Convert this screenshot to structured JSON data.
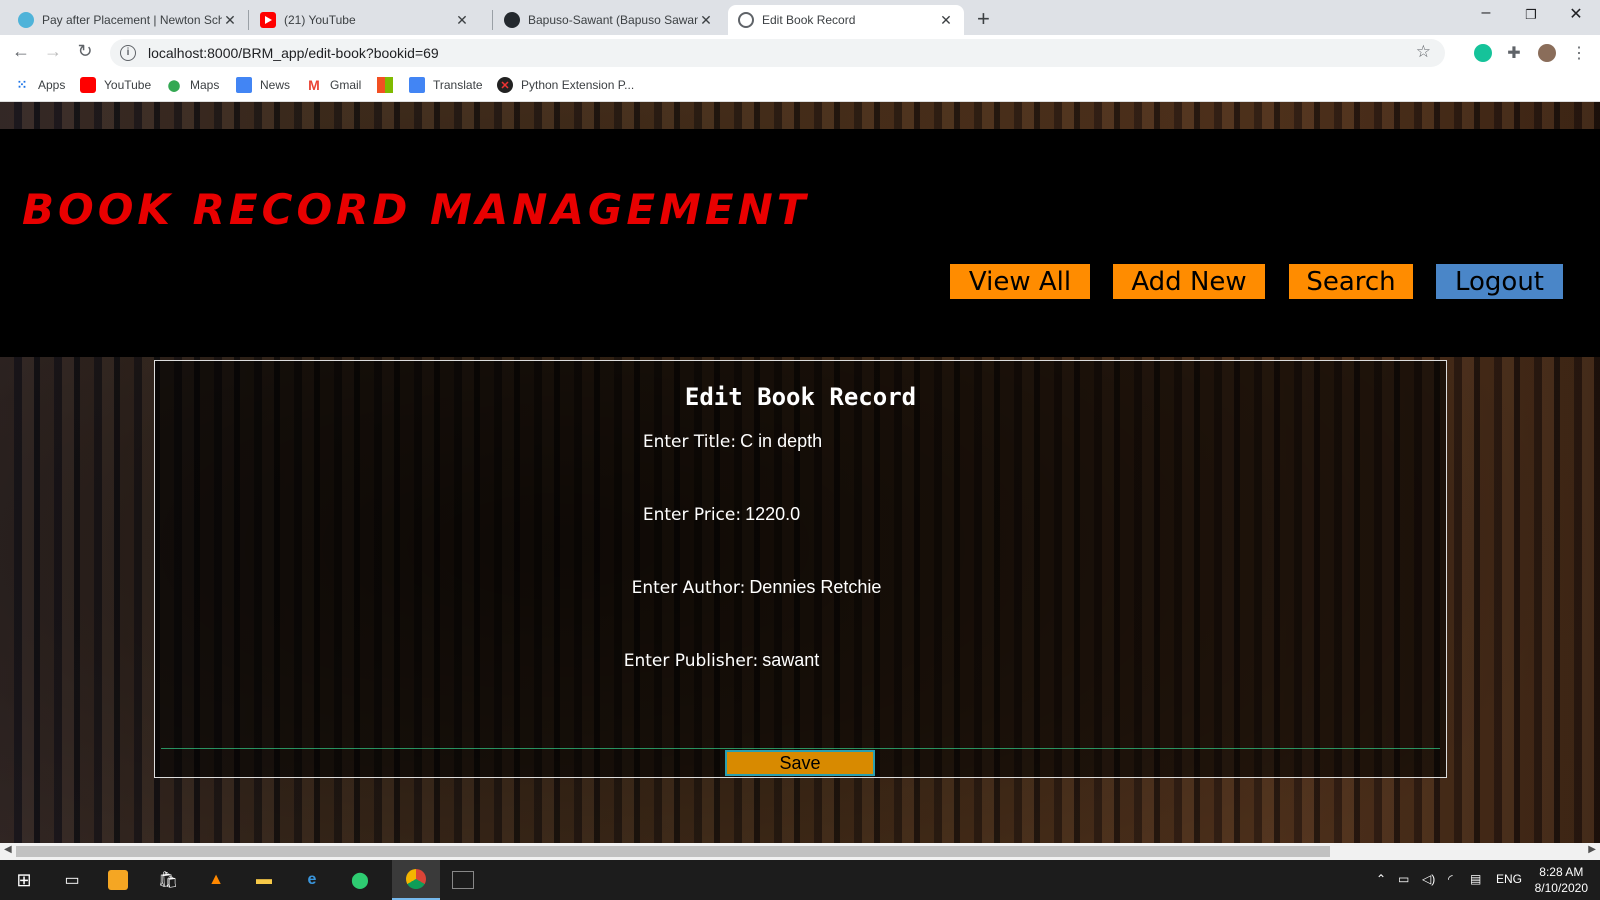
{
  "browser": {
    "tabs": [
      {
        "label": "Pay after Placement | Newton Sch",
        "active": false
      },
      {
        "label": "(21) YouTube",
        "active": false
      },
      {
        "label": "Bapuso-Sawant (Bapuso Sawant)",
        "active": false
      },
      {
        "label": "Edit Book Record",
        "active": true
      }
    ],
    "url": "localhost:8000/BRM_app/edit-book?bookid=69",
    "bookmarks": [
      "Apps",
      "YouTube",
      "Maps",
      "News",
      "Gmail",
      "Translate",
      "Python Extension P..."
    ]
  },
  "header": {
    "brand": "BOOK RECORD MANAGEMENT",
    "nav": {
      "view_all": "View All",
      "add_new": "Add New",
      "search": "Search",
      "logout": "Logout"
    }
  },
  "form": {
    "title": "Edit Book Record",
    "title_label": "Enter Title:",
    "title_value": "C in depth",
    "price_label": "Enter Price:",
    "price_value": "1220.0",
    "author_label": "Enter Author:",
    "author_value": "Dennies Retchie",
    "publisher_label": "Enter Publisher:",
    "publisher_value": "sawant",
    "save_label": "Save"
  },
  "taskbar": {
    "lang": "ENG",
    "time": "8:28 AM",
    "date": "8/10/2020"
  },
  "colors": {
    "brand": "#e80000",
    "nav_orange": "#ff8c00",
    "nav_blue": "#4a86c8",
    "save": "#d88a00"
  }
}
